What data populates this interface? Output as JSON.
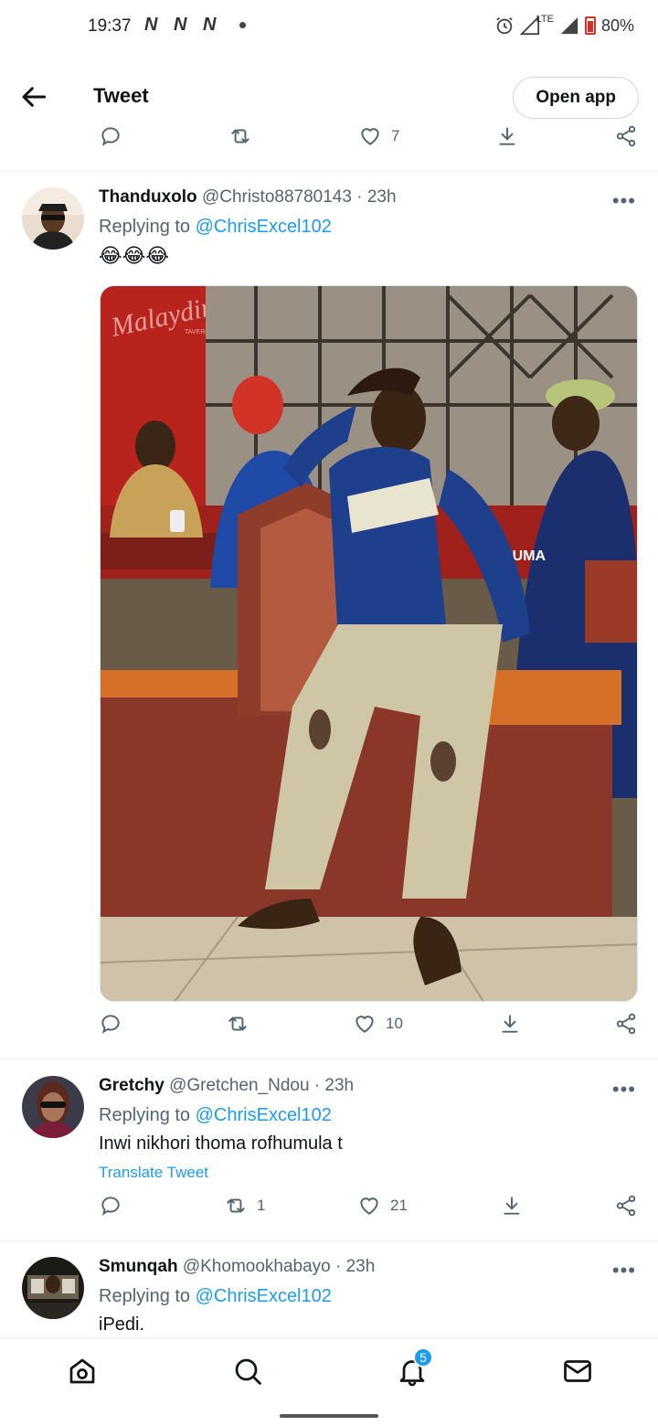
{
  "status_bar": {
    "time": "19:37",
    "net_icons": [
      "N",
      "N",
      "N"
    ],
    "battery": "80%",
    "network": "LTE"
  },
  "header": {
    "title": "Tweet",
    "open_app": "Open app"
  },
  "top_actions": {
    "like_count": "7"
  },
  "tweets": [
    {
      "name": "Thanduxolo",
      "handle": "@Christo88780143 · 23h",
      "replying_prefix": "Replying to ",
      "replying_to": "@ChrisExcel102",
      "text": "😂😂😂",
      "photo_sign": "Malaydini",
      "photo_sign_sub": "TAVERN",
      "photo_brand": "PUMA",
      "retweet_count": "",
      "like_count": "10"
    },
    {
      "name": "Gretchy",
      "handle": "@Gretchen_Ndou · 23h",
      "replying_prefix": "Replying to ",
      "replying_to": "@ChrisExcel102",
      "text": "Inwi nikhori thoma rofhumula t",
      "translate": "Translate Tweet",
      "retweet_count": "1",
      "like_count": "21"
    },
    {
      "name": "Smunqah",
      "handle": "@Khomookhabayo · 23h",
      "replying_prefix": "Replying to ",
      "replying_to": "@ChrisExcel102",
      "text": "iPedi."
    }
  ],
  "more_label": "•••",
  "bottom_nav": {
    "notifications_badge": "5"
  },
  "colors": {
    "accent": "#1d9bf0",
    "text": "#0f1419",
    "muted": "#536471",
    "battery": "#d93025"
  }
}
